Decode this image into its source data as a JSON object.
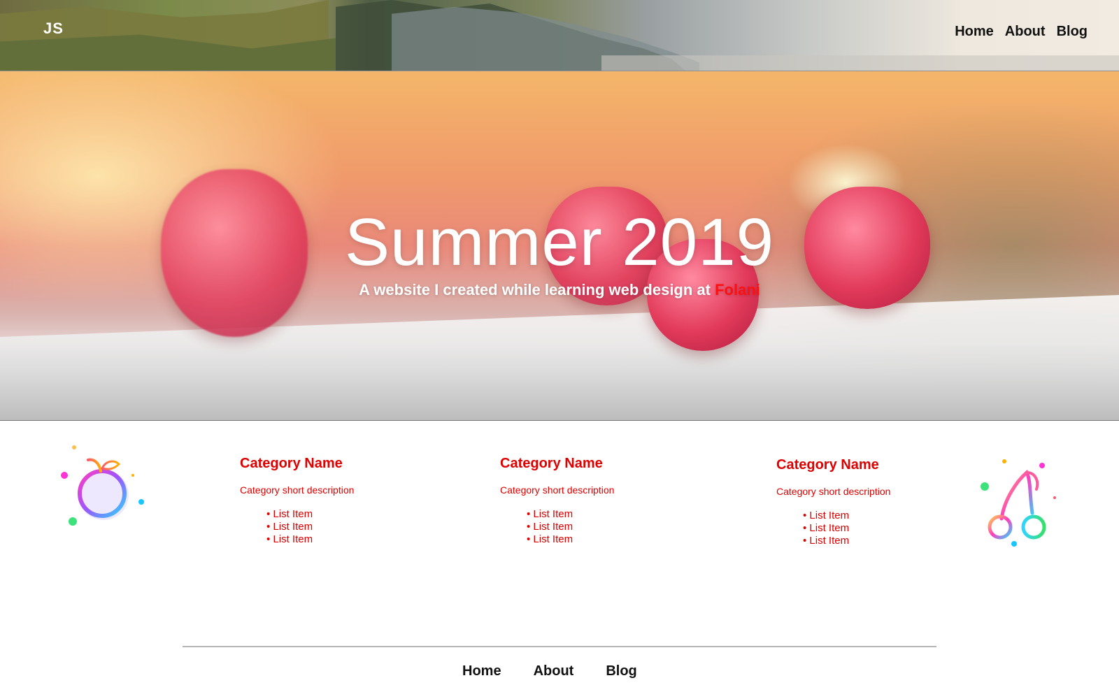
{
  "header": {
    "logo": "JS",
    "nav": [
      "Home",
      "About",
      "Blog"
    ]
  },
  "hero": {
    "title": "Summer 2019",
    "subtitle_prefix": "A website I created while learning web design at ",
    "subtitle_accent": "Folani"
  },
  "categories": [
    {
      "name": "Category Name",
      "description": "Category short description",
      "items": [
        "List Item",
        "List Item",
        "List Item"
      ]
    },
    {
      "name": "Category Name",
      "description": "Category short description",
      "items": [
        "List Item",
        "List Item",
        "List Item"
      ]
    },
    {
      "name": "Category Name",
      "description": "Category short description",
      "items": [
        "List Item",
        "List Item",
        "List Item"
      ]
    }
  ],
  "icons": {
    "left": "peach-icon",
    "right": "cherry-icon"
  },
  "footer": {
    "nav": [
      "Home",
      "About",
      "Blog"
    ]
  },
  "colors": {
    "accent": "#e00000",
    "text_dark": "#111111",
    "divider": "#b6b6b6"
  }
}
